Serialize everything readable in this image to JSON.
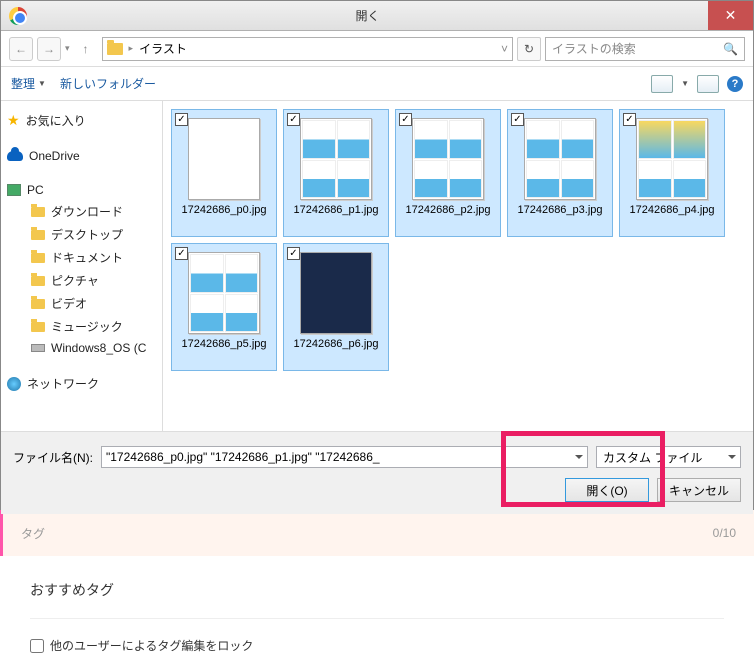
{
  "dialog": {
    "title": "開く",
    "path_folder": "イラスト",
    "search_placeholder": "イラストの検索",
    "toolbar": {
      "organize": "整理",
      "new_folder": "新しいフォルダー"
    },
    "sidebar": {
      "favorites": "お気に入り",
      "onedrive": "OneDrive",
      "pc": "PC",
      "pc_children": [
        "ダウンロード",
        "デスクトップ",
        "ドキュメント",
        "ピクチャ",
        "ビデオ",
        "ミュージック",
        "Windows8_OS (C"
      ],
      "network": "ネットワーク"
    },
    "files": [
      {
        "name": "17242686_p0.jpg",
        "thumb": "single"
      },
      {
        "name": "17242686_p1.jpg",
        "thumb": "grid"
      },
      {
        "name": "17242686_p2.jpg",
        "thumb": "grid"
      },
      {
        "name": "17242686_p3.jpg",
        "thumb": "grid"
      },
      {
        "name": "17242686_p4.jpg",
        "thumb": "yellow"
      },
      {
        "name": "17242686_p5.jpg",
        "thumb": "grid"
      },
      {
        "name": "17242686_p6.jpg",
        "thumb": "dark"
      }
    ],
    "filename_label": "ファイル名(N):",
    "filename_value": "\"17242686_p0.jpg\" \"17242686_p1.jpg\" \"17242686_",
    "filetype_value": "カスタム ファイル",
    "open_btn": "開く(O)",
    "cancel_btn": "キャンセル"
  },
  "under": {
    "tags_label": "タグ",
    "tags_count": "0/10",
    "recommend": "おすすめタグ",
    "lock_label": "他のユーザーによるタグ編集をロック"
  }
}
